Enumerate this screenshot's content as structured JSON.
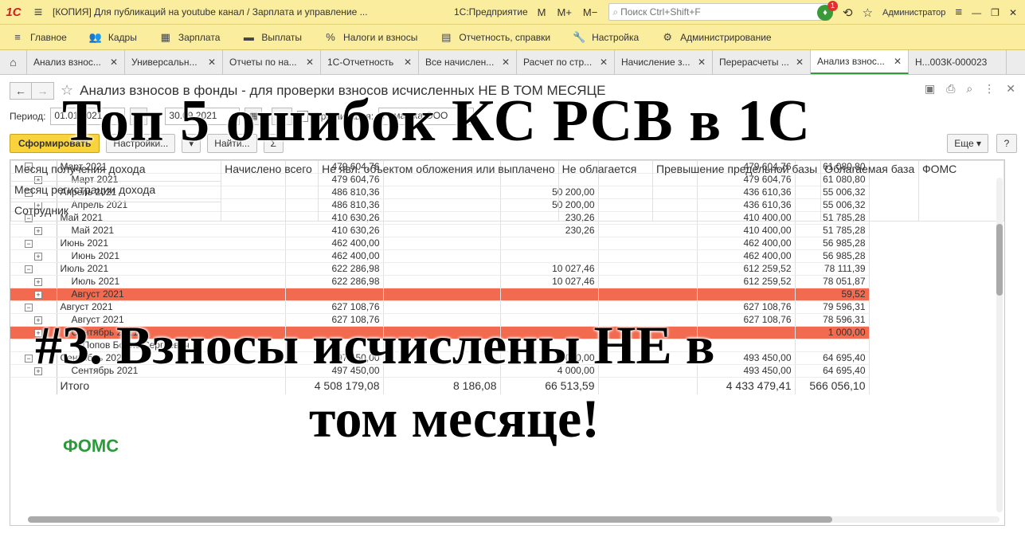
{
  "titlebar": {
    "logo": "1С",
    "title": "[КОПИЯ] Для публикаций на youtube канал / Зарплата и управление ...",
    "app": "1С:Предприятие",
    "mem": [
      "M",
      "M+",
      "M−"
    ],
    "search_placeholder": "Поиск Ctrl+Shift+F",
    "notifications": "1",
    "user": "Администратор"
  },
  "sections": [
    {
      "icon": "≡",
      "label": "Главное"
    },
    {
      "icon": "👥",
      "label": "Кадры"
    },
    {
      "icon": "▦",
      "label": "Зарплата"
    },
    {
      "icon": "▬",
      "label": "Выплаты"
    },
    {
      "icon": "%",
      "label": "Налоги и взносы"
    },
    {
      "icon": "▤",
      "label": "Отчетность, справки"
    },
    {
      "icon": "🔧",
      "label": "Настройка"
    },
    {
      "icon": "⚙",
      "label": "Администрирование"
    }
  ],
  "tabs": [
    "Анализ взнос...",
    "Универсальн...",
    "Отчеты по на...",
    "1С-Отчетность",
    "Все начислен...",
    "Расчет по стр...",
    "Начисление з...",
    "Перерасчеты ...",
    "Анализ взнос...",
    "Н...00ЗК-000023"
  ],
  "form": {
    "title": "Анализ взносов в фонды - для проверки взносов исчисленных НЕ В ТОМ МЕСЯЦЕ",
    "period_label": "Период:",
    "date_from": "01.01.2021",
    "date_to": "30.09.2021",
    "org_label": "Организация:",
    "org_value": "Ромашка ООО",
    "generate": "Сформировать",
    "settings": "Настройки...",
    "find": "Найти...",
    "more": "Еще",
    "help": "?"
  },
  "report": {
    "rows": [
      {
        "level": 0,
        "label": "Март 2021",
        "v": [
          "479 604,76",
          "",
          "",
          "",
          "479 604,76",
          "61 080,80"
        ]
      },
      {
        "level": 1,
        "label": "Март 2021",
        "v": [
          "479 604,76",
          "",
          "",
          "",
          "479 604,76",
          "61 080,80"
        ]
      },
      {
        "level": 0,
        "label": "Апрель 2021",
        "v": [
          "486 810,36",
          "",
          "50 200,00",
          "",
          "436 610,36",
          "55 006,32"
        ]
      },
      {
        "level": 1,
        "label": "Апрель 2021",
        "v": [
          "486 810,36",
          "",
          "50 200,00",
          "",
          "436 610,36",
          "55 006,32"
        ]
      },
      {
        "level": 0,
        "label": "Май 2021",
        "v": [
          "410 630,26",
          "",
          "230,26",
          "",
          "410 400,00",
          "51 785,28"
        ]
      },
      {
        "level": 1,
        "label": "Май 2021",
        "v": [
          "410 630,26",
          "",
          "230,26",
          "",
          "410 400,00",
          "51 785,28"
        ]
      },
      {
        "level": 0,
        "label": "Июнь 2021",
        "v": [
          "462 400,00",
          "",
          "",
          "",
          "462 400,00",
          "56 985,28"
        ]
      },
      {
        "level": 1,
        "label": "Июнь 2021",
        "v": [
          "462 400,00",
          "",
          "",
          "",
          "462 400,00",
          "56 985,28"
        ]
      },
      {
        "level": 0,
        "label": "Июль 2021",
        "v": [
          "622 286,98",
          "",
          "10 027,46",
          "",
          "612 259,52",
          "78 111,39"
        ]
      },
      {
        "level": 1,
        "label": "Июль 2021",
        "v": [
          "622 286,98",
          "",
          "10 027,46",
          "",
          "612 259,52",
          "78 051,87"
        ]
      },
      {
        "level": 1,
        "label": "Август 2021",
        "hl": true,
        "v": [
          "",
          "",
          "",
          "",
          "",
          "59,52"
        ]
      },
      {
        "level": 0,
        "label": "Август 2021",
        "v": [
          "627 108,76",
          "",
          "",
          "",
          "627 108,76",
          "79 596,31"
        ]
      },
      {
        "level": 1,
        "label": "Август 2021",
        "v": [
          "627 108,76",
          "",
          "",
          "",
          "627 108,76",
          "78 596,31"
        ]
      },
      {
        "level": 1,
        "label": "Сентябрь 2021",
        "hl": true,
        "v": [
          "",
          "",
          "",
          "",
          "",
          "1 000,00"
        ]
      },
      {
        "level": 2,
        "label": "Попов Борис Сергеевич",
        "v": [
          "",
          "",
          "",
          "",
          "",
          ""
        ]
      },
      {
        "level": 0,
        "label": "Сентябрь 2021",
        "v": [
          "497 450,00",
          "",
          "4 000,00",
          "",
          "493 450,00",
          "64 695,40"
        ]
      },
      {
        "level": 1,
        "label": "Сентябрь 2021",
        "v": [
          "497 450,00",
          "",
          "4 000,00",
          "",
          "493 450,00",
          "64 695,40"
        ]
      }
    ],
    "total": {
      "label": "Итого",
      "v": [
        "4 508 179,08",
        "8 186,08",
        "66 513,59",
        "",
        "4 433 479,41",
        "566 056,10"
      ]
    },
    "foms_title": "ФОМС",
    "header2": {
      "row_labels": [
        "Месяц получения дохода",
        "Месяц регистрации дохода",
        "Сотрудник"
      ],
      "cols": [
        "Начислено всего",
        "Не явл. объектом обложения или выплачено",
        "Не облагается",
        "Превышение предельной базы",
        "Облагаемая база",
        "ФОМС"
      ]
    }
  },
  "overlay": {
    "line1": "Топ 5 ошибок КС РСВ в 1С",
    "line2": "#3. Взносы исчислены НЕ в",
    "line3": "том месяце!"
  }
}
